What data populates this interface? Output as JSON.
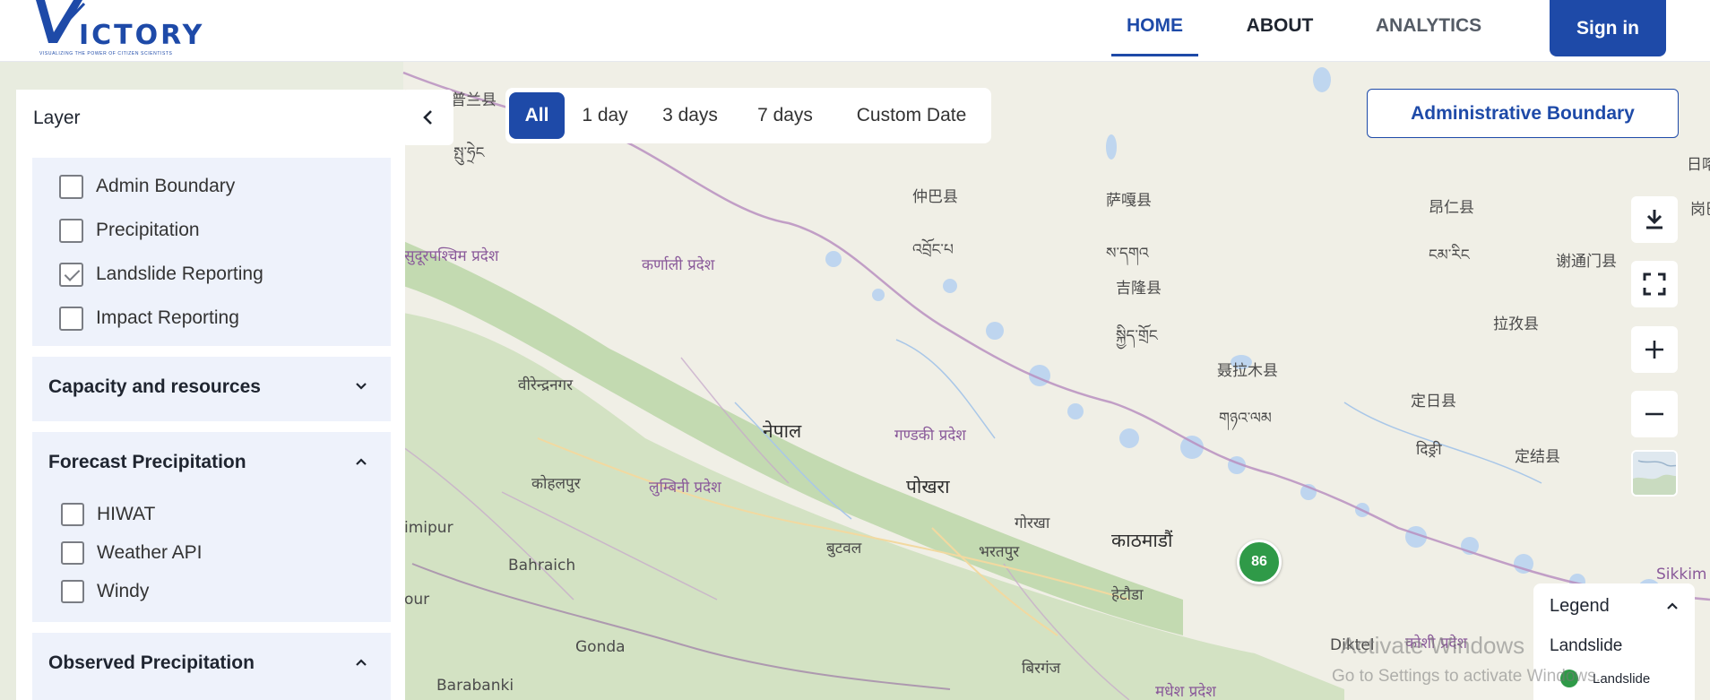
{
  "header": {
    "logo_text": "ICTORY",
    "logo_initial": "V",
    "logo_tagline": "VISUALIZING THE POWER OF CITIZEN SCIENTISTS",
    "nav": [
      {
        "label": "HOME",
        "active": true
      },
      {
        "label": "ABOUT",
        "active": false
      },
      {
        "label": "ANALYTICS",
        "active": false
      }
    ],
    "signin_label": "Sign in"
  },
  "panel": {
    "title": "Layer",
    "layers": [
      {
        "label": "Admin Boundary",
        "checked": false
      },
      {
        "label": "Precipitation",
        "checked": false
      },
      {
        "label": "Landslide Reporting",
        "checked": true
      },
      {
        "label": "Impact Reporting",
        "checked": false
      }
    ],
    "sections": [
      {
        "title": "Capacity and resources",
        "expanded": false
      },
      {
        "title": "Forecast Precipitation",
        "expanded": true,
        "items": [
          {
            "label": "HIWAT",
            "checked": false
          },
          {
            "label": "Weather API",
            "checked": false
          },
          {
            "label": "Windy",
            "checked": false
          }
        ]
      },
      {
        "title": "Observed Precipitation",
        "expanded": true
      }
    ]
  },
  "filters": {
    "options": [
      "All",
      "1 day",
      "3 days",
      "7 days",
      "Custom Date"
    ],
    "selected": "All"
  },
  "admin_boundary_label": "Administrative Boundary",
  "map": {
    "cluster_count": "86",
    "places": {
      "p1": "普兰县",
      "p2": "སྤུ་ཧྲེང",
      "p3": "仲巴县",
      "p4": "འབྲོང་པ",
      "p5": "萨嘎县",
      "p6": "ས་དགའ",
      "p7": "吉隆县",
      "p8": "སྐྱིད་གྲོང",
      "p9": "聂拉木县",
      "p10": "གཉའ་ལམ",
      "p11": "昂仁县",
      "p12": "ངམ་རིང",
      "p13": "谢通门县",
      "p14": "拉孜县",
      "p15": "定日县",
      "p16": "定结县",
      "p17": "दिङ्री",
      "p18": "सुदूरपश्चिम प्रदेश",
      "p19": "कर्णाली प्रदेश",
      "p20": "वीरेन्द्रनगर",
      "p21": "नेपाल",
      "p22": "गण्डकी प्रदेश",
      "p23": "पोखरा",
      "p24": "कोहलपुर",
      "p25": "लुम्बिनी प्रदेश",
      "p26": "गोरखा",
      "p27": "काठमाडौं",
      "p28": "बुटवल",
      "p29": "भरतपुर",
      "p30": "हेटौडा",
      "p31": "Bahraich",
      "p32": "Gonda",
      "p33": "Barabanki",
      "p34": "बिरगंज",
      "p35": "मधेश प्रदेश",
      "p36": "Diktel",
      "p37": "कोशी प्रदेश",
      "p38": "Sikkim",
      "p39": "imipur",
      "p40": "our",
      "p41": "日喀",
      "p42": "岗巴"
    }
  },
  "legend": {
    "title": "Legend",
    "subtitle": "Landslide",
    "items": [
      {
        "label": "Landslide",
        "color": "#2f9a48"
      }
    ]
  },
  "watermark": {
    "line1": "Activate Windows",
    "line2": "Go to Settings to activate Windows."
  },
  "colors": {
    "brand": "#1e4aa8",
    "panel_section_bg": "#eef2fb",
    "landslide": "#2f9a48"
  }
}
